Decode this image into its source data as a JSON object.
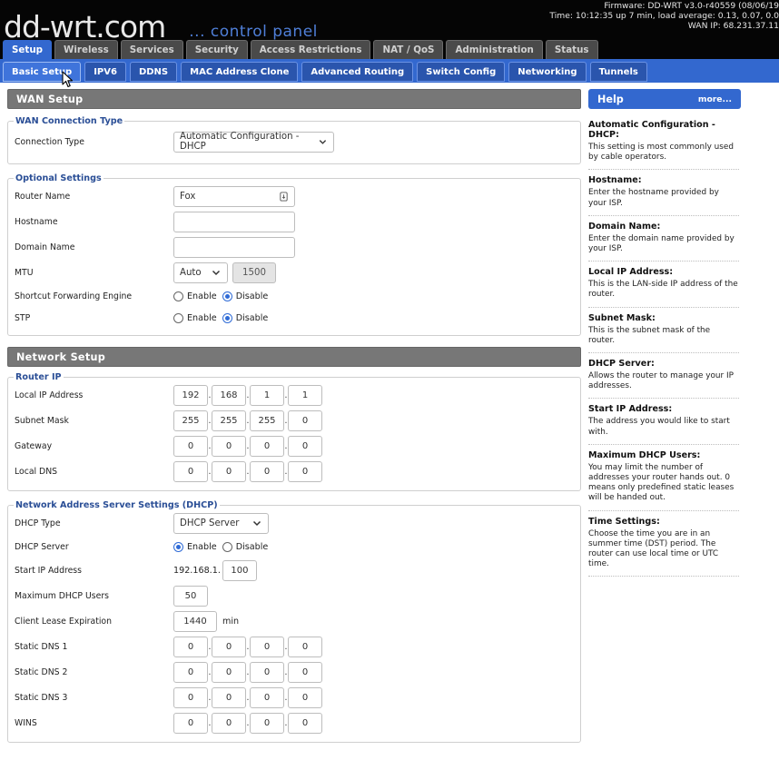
{
  "header": {
    "logo_brand": "dd-wrt.com",
    "logo_sub": "... control panel",
    "firmware": "Firmware: DD-WRT v3.0-r40559 (08/06/19",
    "time": "Time: 10:12:35 up 7 min, load average: 0.13, 0.07, 0.0",
    "wan_ip": "WAN IP: 68.231.37.11"
  },
  "main_tabs": [
    "Setup",
    "Wireless",
    "Services",
    "Security",
    "Access Restrictions",
    "NAT / QoS",
    "Administration",
    "Status"
  ],
  "sub_tabs": [
    "Basic Setup",
    "IPV6",
    "DDNS",
    "MAC Address Clone",
    "Advanced Routing",
    "Switch Config",
    "Networking",
    "Tunnels"
  ],
  "wan_setup": {
    "title": "WAN Setup",
    "conn_type_legend": "WAN Connection Type",
    "conn_type_label": "Connection Type",
    "conn_type_value": "Automatic Configuration - DHCP"
  },
  "optional": {
    "legend": "Optional Settings",
    "router_name_label": "Router Name",
    "router_name_value": "Fox",
    "hostname_label": "Hostname",
    "hostname_value": "",
    "domain_label": "Domain Name",
    "domain_value": "",
    "mtu_label": "MTU",
    "mtu_mode": "Auto",
    "mtu_value": "1500",
    "sfe_label": "Shortcut Forwarding Engine",
    "stp_label": "STP",
    "enable": "Enable",
    "disable": "Disable"
  },
  "network_setup": {
    "title": "Network Setup",
    "router_ip_legend": "Router IP",
    "local_ip_label": "Local IP Address",
    "local_ip": [
      "192",
      "168",
      "1",
      "1"
    ],
    "subnet_label": "Subnet Mask",
    "subnet": [
      "255",
      "255",
      "255",
      "0"
    ],
    "gateway_label": "Gateway",
    "gateway": [
      "0",
      "0",
      "0",
      "0"
    ],
    "local_dns_label": "Local DNS",
    "local_dns": [
      "0",
      "0",
      "0",
      "0"
    ]
  },
  "dhcp": {
    "legend": "Network Address Server Settings (DHCP)",
    "type_label": "DHCP Type",
    "type_value": "DHCP Server",
    "server_label": "DHCP Server",
    "enable": "Enable",
    "disable": "Disable",
    "start_ip_label": "Start IP Address",
    "start_ip_prefix": "192.168.1.",
    "start_ip_value": "100",
    "max_users_label": "Maximum DHCP Users",
    "max_users_value": "50",
    "lease_label": "Client Lease Expiration",
    "lease_value": "1440",
    "lease_unit": "min",
    "dns1_label": "Static DNS 1",
    "dns1": [
      "0",
      "0",
      "0",
      "0"
    ],
    "dns2_label": "Static DNS 2",
    "dns2": [
      "0",
      "0",
      "0",
      "0"
    ],
    "dns3_label": "Static DNS 3",
    "dns3": [
      "0",
      "0",
      "0",
      "0"
    ],
    "wins_label": "WINS",
    "wins": [
      "0",
      "0",
      "0",
      "0"
    ]
  },
  "help": {
    "title": "Help",
    "more": "more...",
    "items": [
      {
        "title": "Automatic Configuration - DHCP:",
        "desc": "This setting is most commonly used by cable operators."
      },
      {
        "title": "Hostname:",
        "desc": "Enter the hostname provided by your ISP."
      },
      {
        "title": "Domain Name:",
        "desc": "Enter the domain name provided by your ISP."
      },
      {
        "title": "Local IP Address:",
        "desc": "This is the LAN-side IP address of the router."
      },
      {
        "title": "Subnet Mask:",
        "desc": "This is the subnet mask of the router."
      },
      {
        "title": "DHCP Server:",
        "desc": "Allows the router to manage your IP addresses."
      },
      {
        "title": "Start IP Address:",
        "desc": "The address you would like to start with."
      },
      {
        "title": "Maximum DHCP Users:",
        "desc": "You may limit the number of addresses your router hands out. 0 means only predefined static leases will be handed out."
      },
      {
        "title": "Time Settings:",
        "desc": "Choose the time you are in an summer time (DST) period. The router can use local time or UTC time."
      }
    ]
  },
  "colors": {
    "accent": "#3368cf",
    "section_header": "#777777",
    "legend": "#2a4e96"
  }
}
